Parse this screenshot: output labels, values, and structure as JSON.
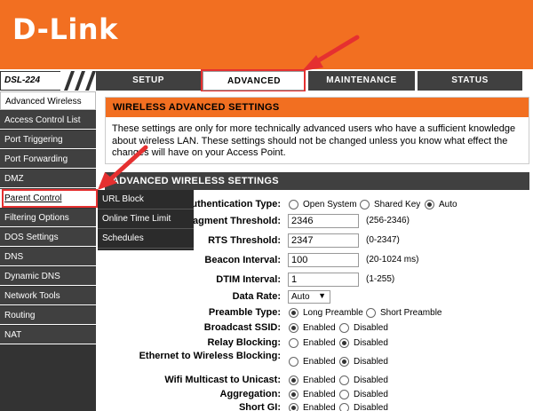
{
  "brand": {
    "logo": "D-Link",
    "model": "DSL-224"
  },
  "tabs": [
    {
      "label": "SETUP"
    },
    {
      "label": "ADVANCED"
    },
    {
      "label": "MAINTENANCE"
    },
    {
      "label": "STATUS"
    }
  ],
  "sidebar": {
    "items": [
      {
        "label": "Advanced Wireless"
      },
      {
        "label": "Access Control List"
      },
      {
        "label": "Port Triggering"
      },
      {
        "label": "Port Forwarding"
      },
      {
        "label": "DMZ"
      },
      {
        "label": "Parent Control"
      },
      {
        "label": "Filtering Options"
      },
      {
        "label": "DOS Settings"
      },
      {
        "label": "DNS"
      },
      {
        "label": "Dynamic DNS"
      },
      {
        "label": "Network Tools"
      },
      {
        "label": "Routing"
      },
      {
        "label": "NAT"
      }
    ]
  },
  "submenu": {
    "items": [
      {
        "label": "URL Block"
      },
      {
        "label": "Online Time Limit"
      },
      {
        "label": "Schedules"
      }
    ]
  },
  "main": {
    "title": "WIRELESS ADVANCED SETTINGS",
    "description": "These settings are only for more technically advanced users who have a sufficient knowledge about wireless LAN. These settings should not be changed unless you know what effect the changes will have on your Access Point.",
    "section_title": "ADVANCED WIRELESS SETTINGS",
    "auth": {
      "label": "Authentication Type:",
      "opt1": "Open System",
      "opt2": "Shared Key",
      "opt3": "Auto"
    },
    "frag": {
      "label": "Fragment Threshold:",
      "value": "2346",
      "hint": "(256-2346)"
    },
    "rts": {
      "label": "RTS Threshold:",
      "value": "2347",
      "hint": "(0-2347)"
    },
    "beacon": {
      "label": "Beacon Interval:",
      "value": "100",
      "hint": "(20-1024 ms)"
    },
    "dtim": {
      "label": "DTIM Interval:",
      "value": "1",
      "hint": "(1-255)"
    },
    "datarate": {
      "label": "Data Rate:",
      "value": "Auto"
    },
    "preamble": {
      "label": "Preamble Type:",
      "opt1": "Long Preamble",
      "opt2": "Short Preamble"
    },
    "broadcast": {
      "label": "Broadcast SSID:",
      "on": "Enabled",
      "off": "Disabled"
    },
    "relay": {
      "label": "Relay Blocking:",
      "on": "Enabled",
      "off": "Disabled"
    },
    "eth2w": {
      "label": "Ethernet to Wireless Blocking:",
      "on": "Enabled",
      "off": "Disabled"
    },
    "wmc": {
      "label": "Wifi Multicast to Unicast:",
      "on": "Enabled",
      "off": "Disabled"
    },
    "aggr": {
      "label": "Aggregation:",
      "on": "Enabled",
      "off": "Disabled"
    },
    "sgi": {
      "label": "Short GI:",
      "on": "Enabled",
      "off": "Disabled"
    }
  }
}
